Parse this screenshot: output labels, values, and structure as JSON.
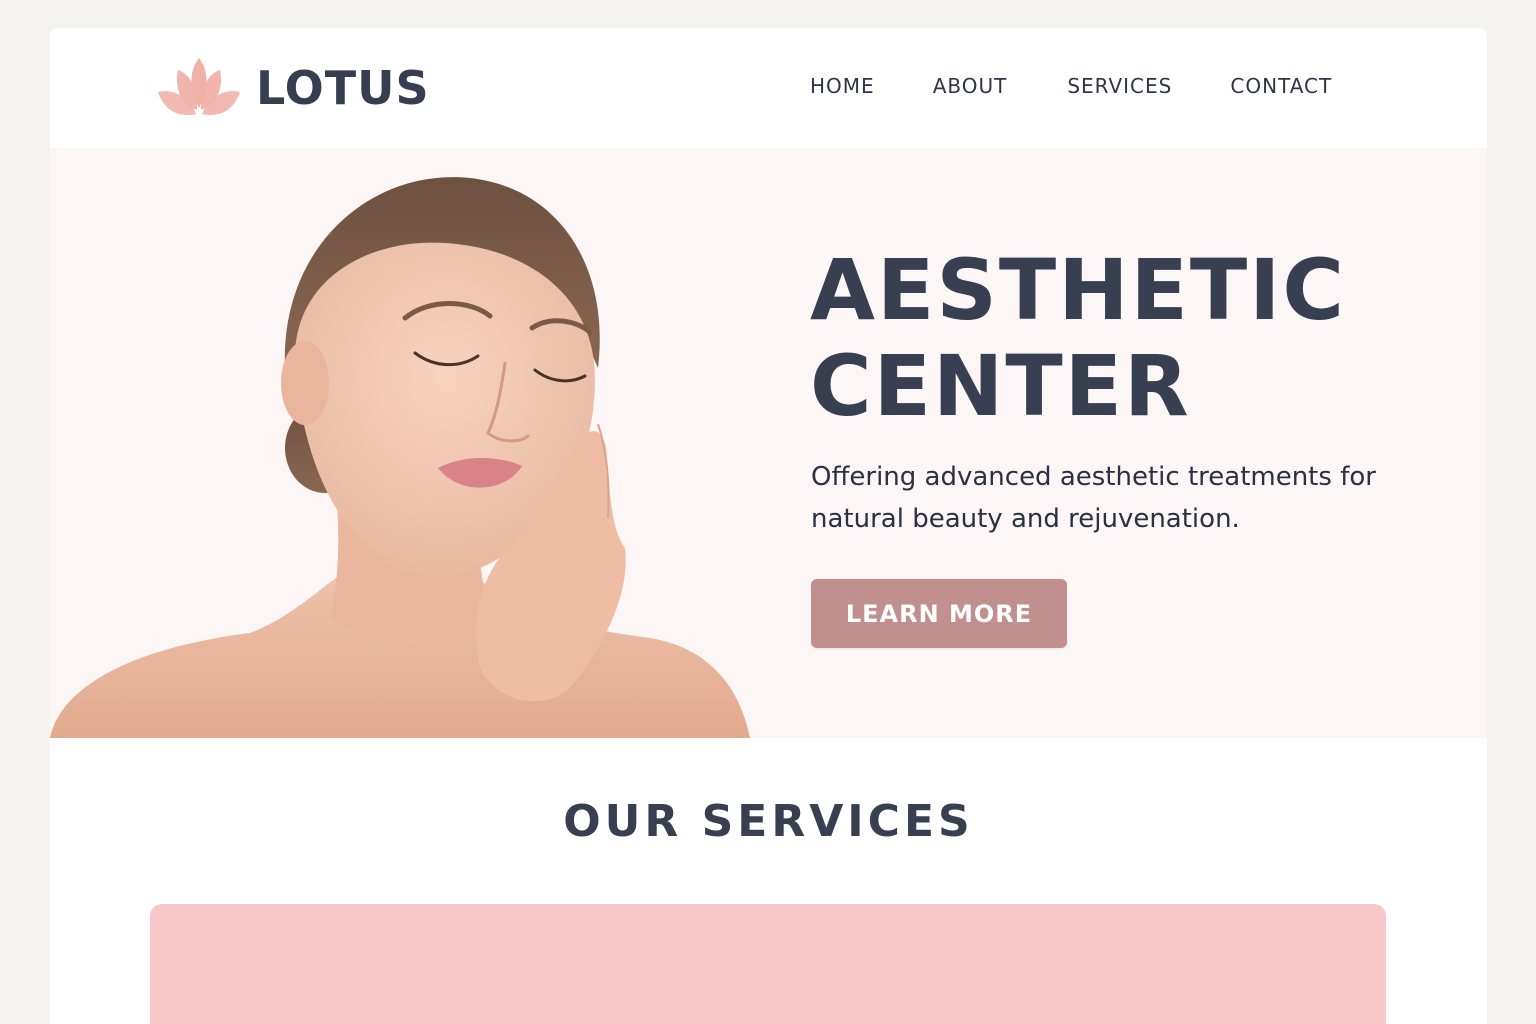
{
  "brand": {
    "name": "LOTUS",
    "logo_icon": "lotus-flower-icon",
    "accent_color": "#f0b1a6"
  },
  "nav": {
    "items": [
      {
        "label": "HOME"
      },
      {
        "label": "ABOUT"
      },
      {
        "label": "SERVICES"
      },
      {
        "label": "CONTACT"
      }
    ]
  },
  "hero": {
    "title_line1": "AESTHETIC",
    "title_line2": "CENTER",
    "subtitle": "Offering advanced aesthetic treatments for natural beauty and rejuvenation.",
    "button_label": "LEARN MORE",
    "button_color": "#c28f8f",
    "background_color": "#fcf6f6"
  },
  "services": {
    "heading": "OUR SERVICES",
    "card_color": "#f8c8c8"
  }
}
